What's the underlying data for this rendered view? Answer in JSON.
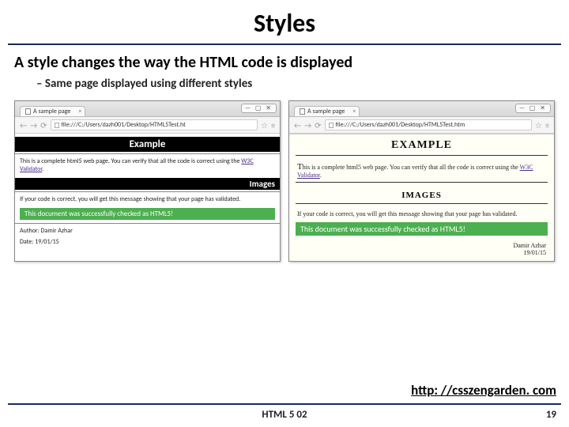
{
  "slide": {
    "title": "Styles",
    "subtitle": "A style changes the way the HTML code is displayed",
    "bullet": "Same page displayed using different styles",
    "link": "http: //csszengarden. com",
    "footer_left": "HTML 5 02",
    "page_number": "19"
  },
  "window_controls": "— ▢ ✕",
  "left": {
    "tab_title": "A sample page",
    "tab_close": "×",
    "nav_back": "←",
    "nav_fwd": "→",
    "nav_reload": "⟳",
    "url": "file:///C:/Users/dazh001/Desktop/HTML5Test.ht",
    "bookmark": "☆",
    "menu": "≡",
    "h1": "Example",
    "p1_a": "This is a complete html5 web page. You can verify that all the code is correct using the ",
    "p1_link": "W3C Validator",
    "p1_b": ".",
    "h2": "Images",
    "p2": "If your code is correct, you will get this message showing that your page has validated.",
    "ok": "This document was successfully checked as HTML5!",
    "author_label": "Author: ",
    "author_name": "Damir Azhar",
    "date_label": "Date: ",
    "date_val": "19/01/15"
  },
  "right": {
    "tab_title": "A sample page",
    "tab_close": "×",
    "nav_back": "←",
    "nav_fwd": "→",
    "nav_reload": "⟳",
    "url": "file:///C:/Users/dazh001/Desktop/HTML5Test.htm",
    "bookmark": "☆",
    "menu": "≡",
    "h1": "EXAMPLE",
    "p1_cap": "T",
    "p1_a": "his is a complete html5 web page. You can verify that all the code is correct using the ",
    "p1_link": "W3C Validator",
    "p1_b": ".",
    "h2": "IMAGES",
    "p2": "If your code is correct, you will get this message showing that your page has validated.",
    "ok": "This document was successfully checked as HTML5!",
    "author_name": "Damir Azhar",
    "date_val": "19/01/15"
  }
}
